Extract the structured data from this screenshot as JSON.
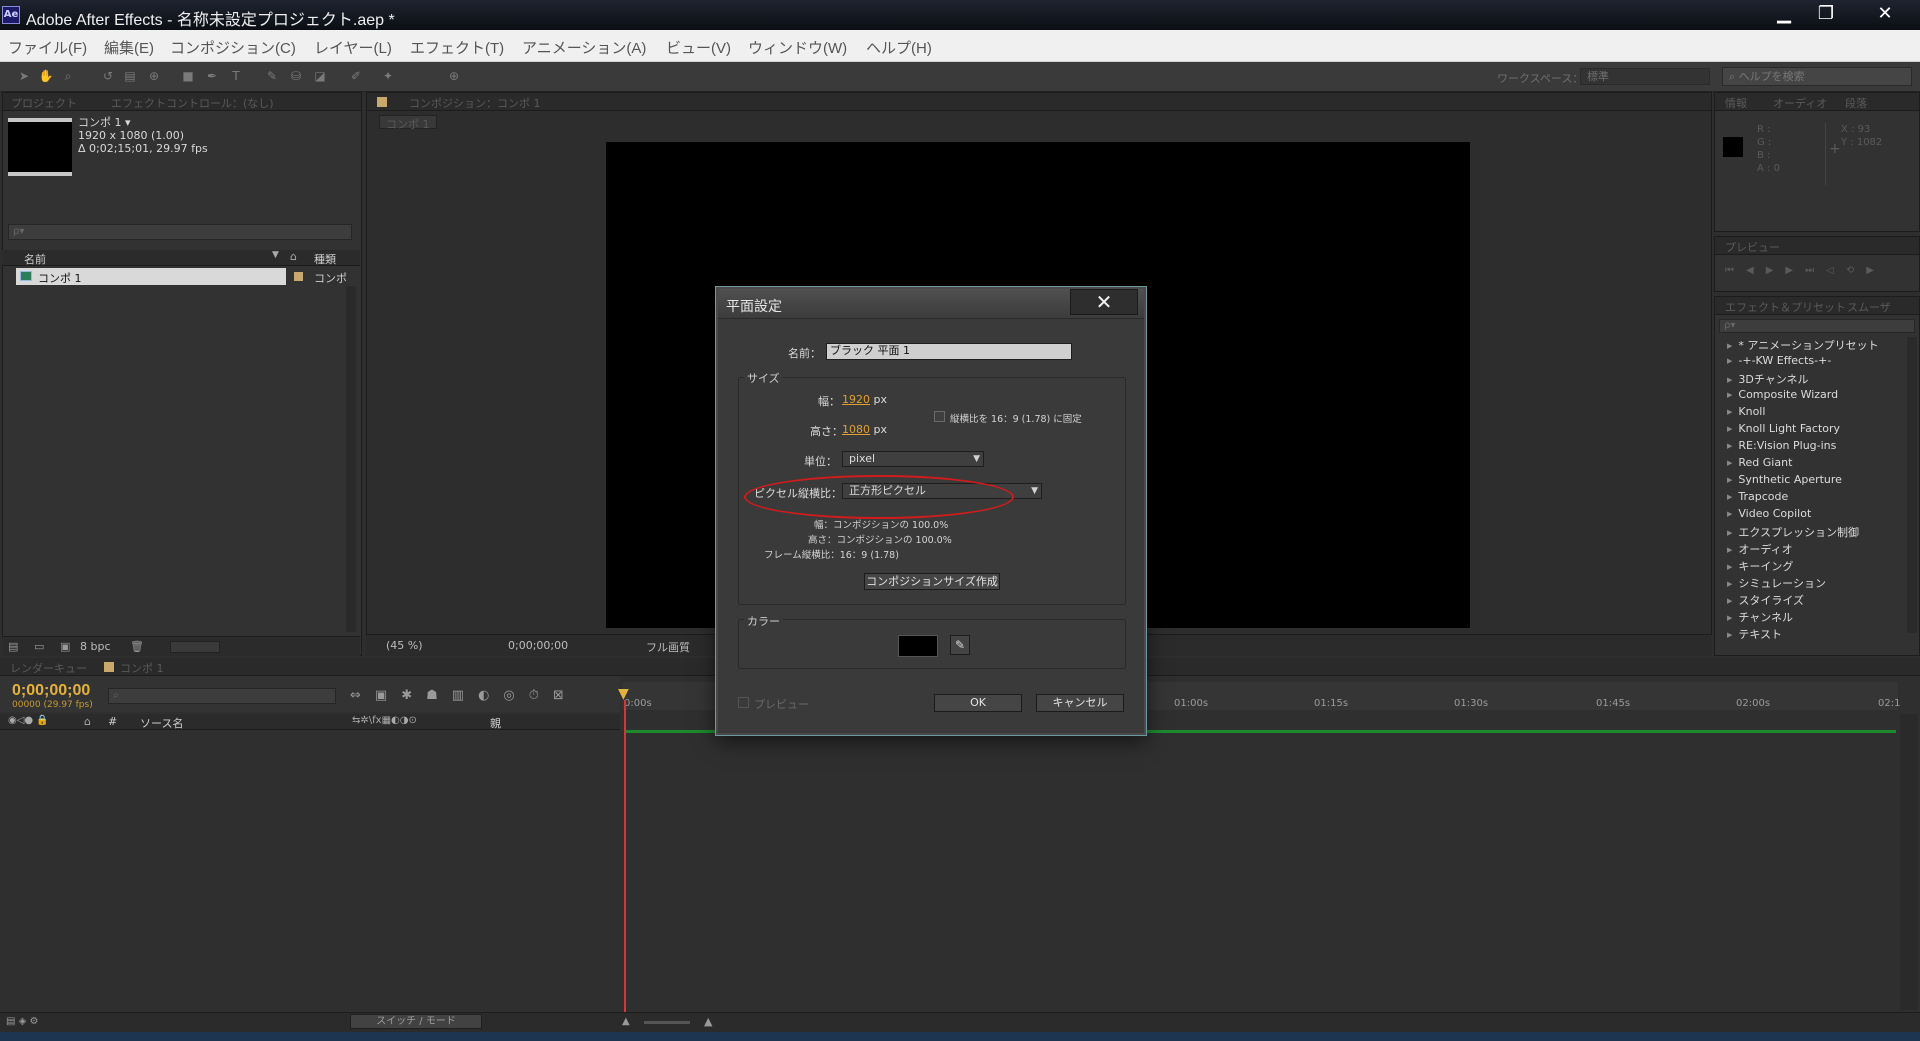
{
  "window": {
    "title": "Adobe After Effects - 名称未設定プロジェクト.aep *",
    "app_icon": "Ae",
    "minimize": "▁",
    "maximize": "❐",
    "close": "✕"
  },
  "menu": [
    "ファイル(F)",
    "編集(E)",
    "コンポジション(C)",
    "レイヤー(L)",
    "エフェクト(T)",
    "アニメーション(A)",
    "ビュー(V)",
    "ウィンドウ(W)",
    "ヘルプ(H)"
  ],
  "toolbar": {
    "workspace_label": "ワークスペース：",
    "workspace_value": "標準",
    "help_search_placeholder": "ヘルプを検索"
  },
  "project_panel": {
    "tabs": [
      "プロジェクト",
      "エフェクトコントロール：(なし)"
    ],
    "item_name": "コンポ 1 ▾",
    "item_size": "1920 x 1080 (1.00)",
    "item_duration": "Δ 0;02;15;01, 29.97 fps",
    "search_placeholder": "ρ▾",
    "col_name": "名前",
    "col_type": "種類",
    "row_name": "コンポ 1",
    "row_type": "コンポ",
    "bpc": "8 bpc"
  },
  "comp_panel": {
    "tab": "コンポジション：コンポ 1",
    "subtab": "コンポ 1",
    "zoom": "(45 %)",
    "timecode": "0;00;00;00",
    "resolution": "フル画質"
  },
  "info_panel": {
    "tabs": [
      "情報",
      "オーディオ",
      "段落"
    ],
    "r": "R :",
    "g": "G :",
    "b": "B :",
    "a": "A : 0",
    "x": "X : 93",
    "y": "Y : 1082"
  },
  "preview_panel": {
    "tab": "プレビュー"
  },
  "effects_panel": {
    "tabs": [
      "エフェクト＆プリセット",
      "スムーザ"
    ],
    "search_placeholder": "ρ▾",
    "items": [
      "* アニメーションプリセット",
      "-+-KW Effects-+-",
      "3Dチャンネル",
      "Composite Wizard",
      "Knoll",
      "Knoll Light Factory",
      "RE:Vision Plug-ins",
      "Red Giant",
      "Synthetic Aperture",
      "Trapcode",
      "Video Copilot",
      "エクスプレッション制御",
      "オーディオ",
      "キーイング",
      "シミュレーション",
      "スタイライズ",
      "チャンネル",
      "テキスト"
    ]
  },
  "timeline": {
    "tabs": [
      "レンダーキュー",
      "コンポ 1"
    ],
    "timecode": "0;00;00;00",
    "timecode_sub": "00000 (29.97 fps)",
    "col_source": "ソース名",
    "col_parent": "親",
    "col_num": "#",
    "ticks": [
      "0:00s",
      "01:00s",
      "01:15s",
      "01:30s",
      "01:45s",
      "02:00s",
      "02:1"
    ],
    "switch_mode": "スイッチ / モード"
  },
  "dialog": {
    "title": "平面設定",
    "close": "✕",
    "name_label": "名前：",
    "name_value": "ブラック 平面 1",
    "size_group": "サイズ",
    "width_label": "幅：",
    "width_value": "1920",
    "height_label": "高さ：",
    "height_value": "1080",
    "px": "px",
    "lock_label": "縦横比を 16：9 (1.78) に固定",
    "unit_label": "単位：",
    "unit_value": "pixel",
    "pixel_aspect_label": "ピクセル縦横比：",
    "pixel_aspect_value": "正方形ピクセル",
    "info_width": "幅：コンポジションの 100.0%",
    "info_height": "高さ：コンポジションの 100.0%",
    "info_frame": "フレーム縦横比：16：9 (1.78)",
    "make_comp_size": "コンポジションサイズ作成",
    "color_group": "カラー",
    "color_value": "#000000",
    "preview_label": "プレビュー",
    "ok": "OK",
    "cancel": "キャンセル"
  }
}
